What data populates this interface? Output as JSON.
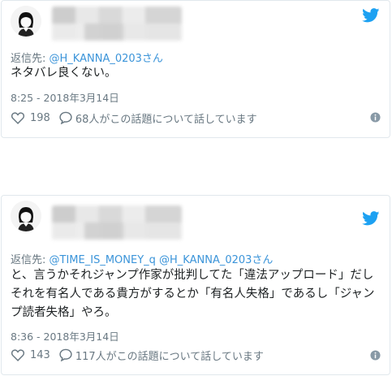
{
  "tweets": [
    {
      "reply_prefix": "返信先:",
      "reply_to": "@H_KANNA_0203さん",
      "text": "ネタバレ良くない。",
      "timestamp": "8:25 - 2018年3月14日",
      "likes": "198",
      "discussion": "68人がこの話題について話しています"
    },
    {
      "reply_prefix": "返信先:",
      "reply_to": "@TIME_IS_MONEY_q @H_KANNA_0203さん",
      "text_lines": [
        "と、言うかそれジャンプ作家が批判してた「違法アップロード」だし",
        "それを有名人である貴方がするとか「有名人失格」であるし「ジャン",
        "プ読者失格」やろ。"
      ],
      "timestamp": "8:36 - 2018年3月14日",
      "likes": "143",
      "discussion": "117人がこの話題について話しています"
    }
  ],
  "colors": {
    "accent_blue": "#1da1f2",
    "link_blue": "#3b94d9",
    "meta_gray": "#697882",
    "text": "#1c2022"
  },
  "icons": [
    "twitter-bird-icon",
    "heart-icon",
    "speech-bubble-icon",
    "info-icon"
  ]
}
